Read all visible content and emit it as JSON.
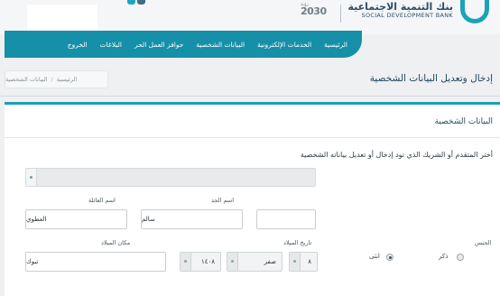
{
  "header": {
    "bank_name_ar": "بنك التنمية الاجتماعية",
    "bank_name_en": "SOCIAL DEVELOPMENT BANK",
    "vision": "2030",
    "vision_small": "رؤية"
  },
  "nav": {
    "items": [
      "الرئيسية",
      "الخدمات الإلكترونية",
      "البيانات الشخصية",
      "حوافز العمل الحر",
      "البلاغات",
      "الخروج"
    ]
  },
  "breadcrumb": {
    "home": "الرئيسية",
    "separator": "/",
    "current": "البيانات الشخصية"
  },
  "page_title": "إدخال وتعديل البيانات الشخصية",
  "form": {
    "section_title": "البيانات الشخصية",
    "question": "أختر المتقدم أو الشريك الذي تود إدخال أو تعديل بياناته الشخصية",
    "family_name_label": "اسم العائلة",
    "family_name_value": "العطوي",
    "grandfather_label": "اسم الجد",
    "grandfather_value": "سالم",
    "dob_label": "تاريخ الميلاد",
    "dob_day": "٨",
    "dob_month": "صفر",
    "dob_year": "١٤٠٨",
    "birthplace_label": "مكان الميلاد",
    "birthplace_value": "تبوك",
    "gender_label": "الجنس",
    "gender_male": "ذكر",
    "gender_female": "انثى",
    "gender_selected": "انثى"
  },
  "colors": {
    "brand": "#1590a8",
    "accent": "#1aa0b8",
    "title": "#23465a"
  }
}
